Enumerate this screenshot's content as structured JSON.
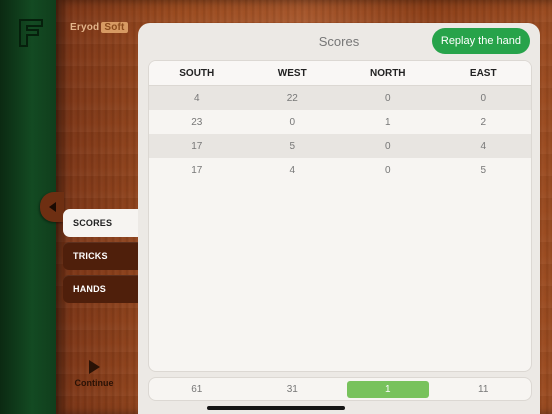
{
  "brand": {
    "name": "Eryod",
    "highlight": "Soft"
  },
  "header": {
    "title": "Scores",
    "replay_label": "Replay the hand"
  },
  "sidebar": {
    "tabs": [
      {
        "label": "SCORES",
        "active": true
      },
      {
        "label": "TRICKS",
        "active": false
      },
      {
        "label": "HANDS",
        "active": false
      }
    ],
    "continue_label": "Continue"
  },
  "scores": {
    "columns": [
      "SOUTH",
      "WEST",
      "NORTH",
      "EAST"
    ],
    "rows": [
      [
        "4",
        "22",
        "0",
        "0"
      ],
      [
        "23",
        "0",
        "1",
        "2"
      ],
      [
        "17",
        "5",
        "0",
        "4"
      ],
      [
        "17",
        "4",
        "0",
        "5"
      ]
    ],
    "totals": [
      "61",
      "31",
      "1",
      "11"
    ],
    "leader_index": 2
  },
  "colors": {
    "accent_green": "#27a34a",
    "leader_green": "#78c25c",
    "felt_green": "#134a22",
    "wood": "#9a4a1e"
  }
}
